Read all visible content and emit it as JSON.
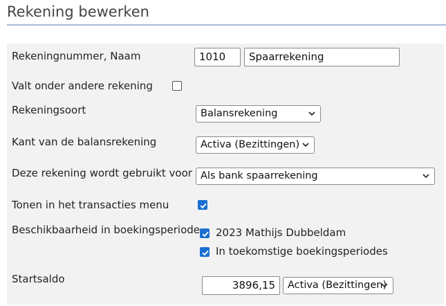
{
  "page": {
    "title": "Rekening bewerken"
  },
  "form": {
    "account_number_name": {
      "label": "Rekeningnummer, Naam",
      "number": "1010",
      "name": "Spaarrekening"
    },
    "parent_account": {
      "label": "Valt onder andere rekening",
      "checked": false
    },
    "account_type": {
      "label": "Rekeningsoort",
      "value": "Balansrekening"
    },
    "balance_side": {
      "label": "Kant van de balansrekening",
      "value": "Activa (Bezittingen)"
    },
    "usage": {
      "label": "Deze rekening wordt gebruikt voor",
      "value": "Als bank spaarrekening"
    },
    "show_in_menu": {
      "label": "Tonen in het transacties menu",
      "checked": true
    },
    "availability": {
      "label": "Beschikbaarheid in boekingsperiode",
      "options": [
        {
          "label": "2023 Mathijs Dubbeldam",
          "checked": true
        },
        {
          "label": "In toekomstige boekingsperiodes",
          "checked": true
        }
      ]
    },
    "opening_balance": {
      "label": "Startsaldo",
      "amount": "3896,15",
      "side": "Activa (Bezittingen)"
    }
  },
  "colors": {
    "accent": "#1a6fd1",
    "row_bg": "#f2f2f2",
    "title_rule": "#aabbdd"
  },
  "icons": {
    "select": "chevron-down-icon",
    "checkbox_checked": "checkmark-icon"
  }
}
